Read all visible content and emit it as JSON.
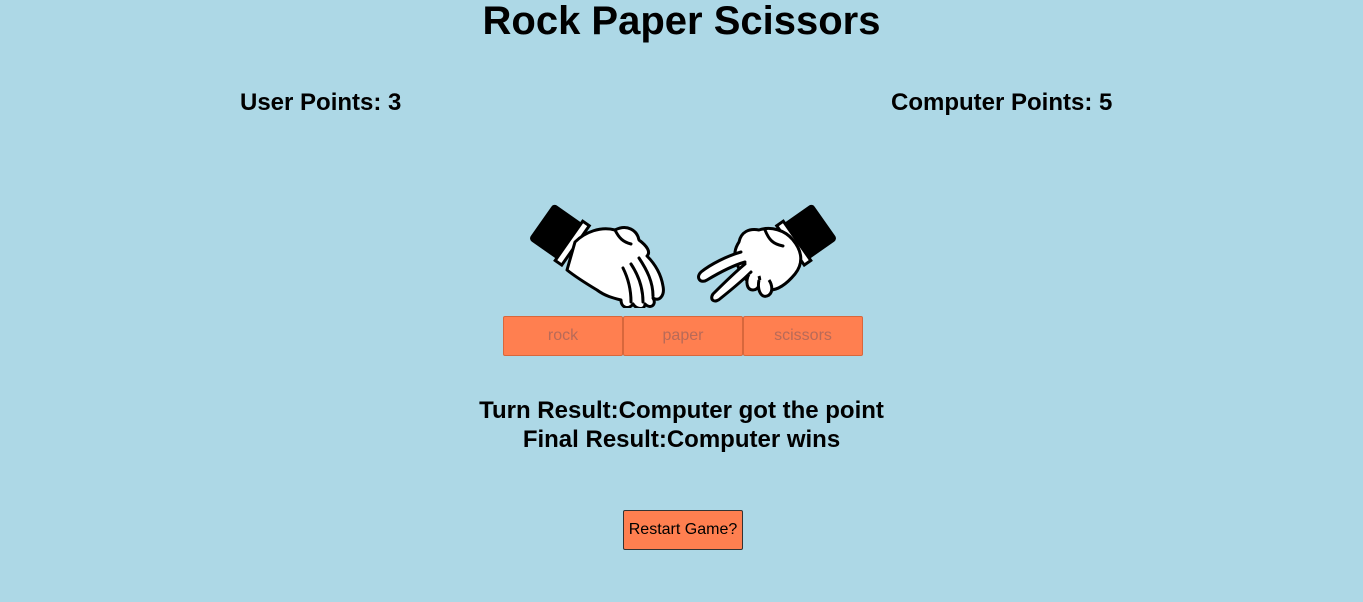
{
  "title": "Rock Paper Scissors",
  "scores": {
    "user_label": "User Points: 3",
    "computer_label": "Computer Points: 5"
  },
  "hands": {
    "user_icon": "paper-hand-icon",
    "computer_icon": "scissors-hand-icon"
  },
  "choices": {
    "rock": "rock",
    "paper": "paper",
    "scissors": "scissors"
  },
  "results": {
    "turn": "Turn Result:Computer got the point",
    "final": "Final Result:Computer wins"
  },
  "restart_label": "Restart Game?",
  "colors": {
    "background": "#add8e6",
    "button": "#ff7f50",
    "disabled_text": "#b86a58"
  }
}
